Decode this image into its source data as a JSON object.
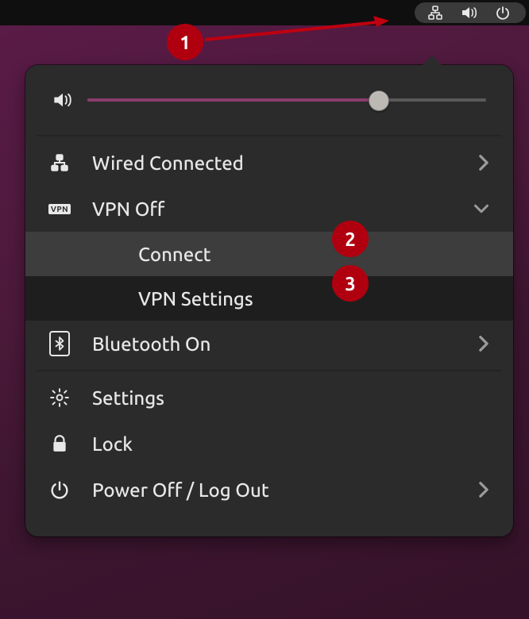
{
  "annotations": {
    "badge1": "1",
    "badge2": "2",
    "badge3": "3"
  },
  "topbar": {
    "network_icon": "network-wired",
    "volume_icon": "volume-high",
    "power_icon": "power"
  },
  "volume": {
    "percent": 73
  },
  "menu": {
    "wired": {
      "label": "Wired Connected",
      "expand": "right"
    },
    "vpn": {
      "label": "VPN Off",
      "expand": "down",
      "items": {
        "connect": "Connect",
        "settings": "VPN Settings"
      }
    },
    "bluetooth": {
      "label": "Bluetooth On",
      "expand": "right"
    },
    "settings": {
      "label": "Settings"
    },
    "lock": {
      "label": "Lock"
    },
    "power": {
      "label": "Power Off / Log Out",
      "expand": "right"
    }
  }
}
